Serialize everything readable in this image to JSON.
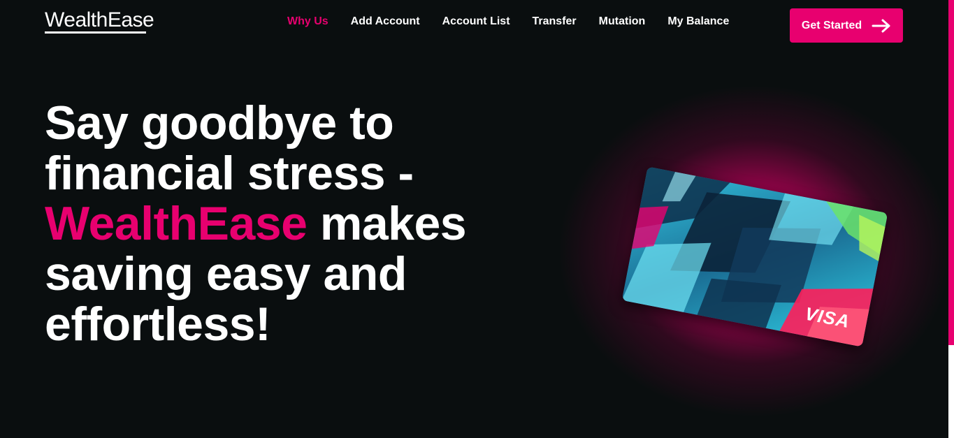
{
  "brand": {
    "name": "WealthEase"
  },
  "nav": {
    "items": [
      {
        "label": "Why Us",
        "active": true
      },
      {
        "label": "Add Account"
      },
      {
        "label": "Account List"
      },
      {
        "label": "Transfer"
      },
      {
        "label": "Mutation"
      },
      {
        "label": "My Balance"
      }
    ]
  },
  "cta": {
    "label": "Get Started",
    "icon": "arrow-right-icon"
  },
  "hero": {
    "line1": "Say goodbye to",
    "line2": "financial stress -",
    "accent": "WealthEase",
    "line3_rest": " makes",
    "line4": "saving easy and",
    "line5": "effortless!"
  },
  "card": {
    "network": "VISA"
  },
  "colors": {
    "background": "#0a0e0f",
    "accent": "#e8006f",
    "text": "#ffffff"
  }
}
